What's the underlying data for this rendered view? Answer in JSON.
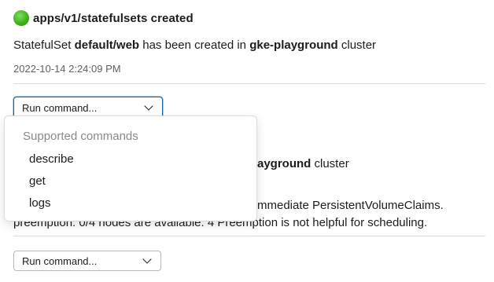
{
  "first_message": {
    "title": "apps/v1/statefulsets created",
    "text_prefix": "StatefulSet ",
    "resource": "default/web",
    "text_middle": " has been created in ",
    "cluster": "gke-playground",
    "text_suffix": " cluster",
    "timestamp": "2022-10-14 2:24:09 PM",
    "status_color": "#3fb21f"
  },
  "run_command_select": {
    "placeholder": "Run command..."
  },
  "dropdown": {
    "header": "Supported commands",
    "options": [
      "describe",
      "get",
      "logs"
    ]
  },
  "second_message": {
    "cluster_partial": "ayground",
    "text_suffix": " cluster",
    "line1": "mmediate PersistentVolumeClaims.",
    "line2": "preemption: 0/4 nodes are available: 4 Preemption is not helpful for scheduling."
  },
  "run_command_select_2": {
    "placeholder": "Run command..."
  },
  "colors": {
    "focus_border": "#1264a3",
    "muted_text": "#616061"
  }
}
